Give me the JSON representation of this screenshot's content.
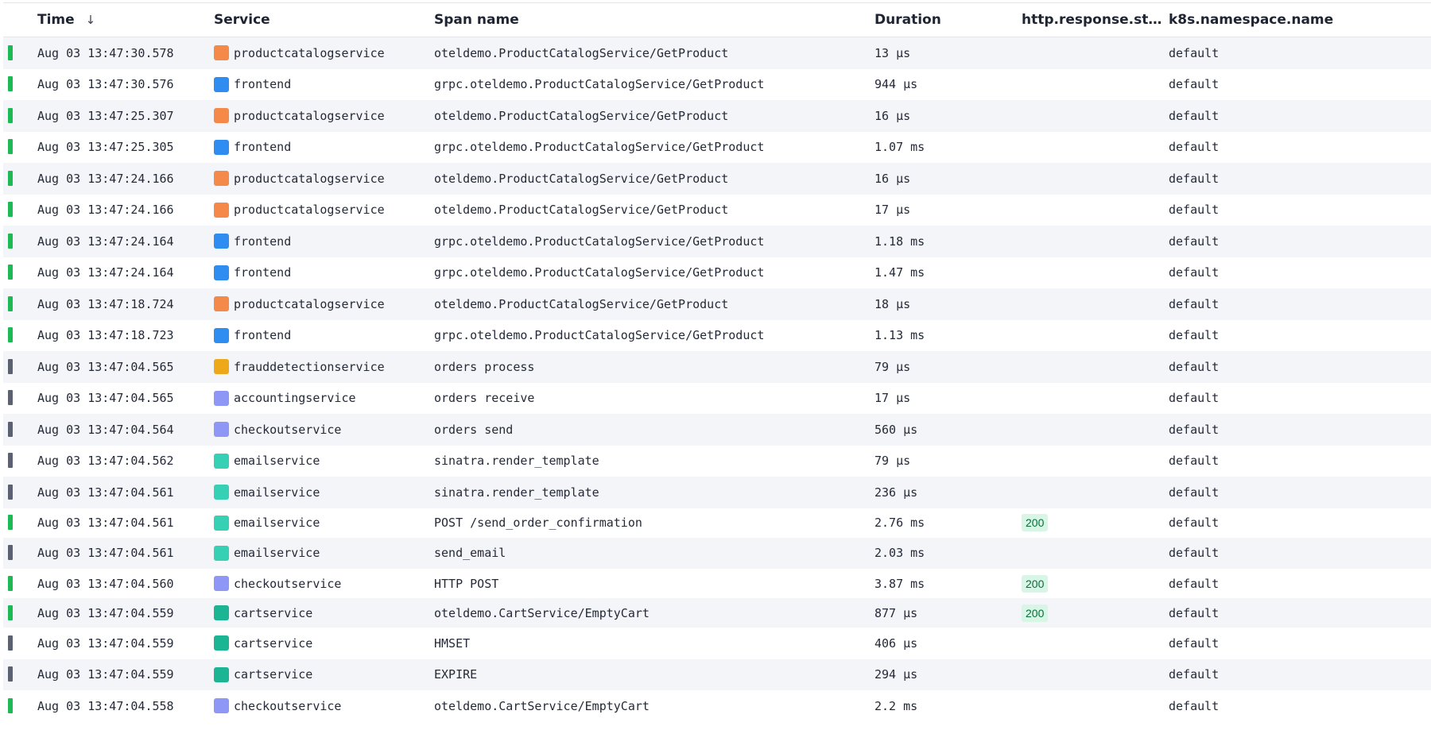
{
  "columns": {
    "time": "Time",
    "service": "Service",
    "span_name": "Span name",
    "duration": "Duration",
    "http_status": "http.response.stat…",
    "namespace": "k8s.namespace.name"
  },
  "sort_icon": "arrow-down-icon",
  "colors": {
    "status_ok": "#1db954",
    "status_unset": "#5b6170",
    "productcatalogservice": "#f5894a",
    "frontend": "#2f8cf0",
    "frauddetectionservice": "#eda91a",
    "accountingservice": "#8e97f5",
    "checkoutservice": "#8e97f5",
    "emailservice": "#36d1b4",
    "cartservice": "#1bb593"
  },
  "rows": [
    {
      "status": "ok",
      "time": "Aug 03 13:47:30.578",
      "service": "productcatalogservice",
      "span": "oteldemo.ProductCatalogService/GetProduct",
      "duration": "13 μs",
      "http": "",
      "namespace": "default"
    },
    {
      "status": "ok",
      "time": "Aug 03 13:47:30.576",
      "service": "frontend",
      "span": "grpc.oteldemo.ProductCatalogService/GetProduct",
      "duration": "944 μs",
      "http": "",
      "namespace": "default"
    },
    {
      "status": "ok",
      "time": "Aug 03 13:47:25.307",
      "service": "productcatalogservice",
      "span": "oteldemo.ProductCatalogService/GetProduct",
      "duration": "16 μs",
      "http": "",
      "namespace": "default"
    },
    {
      "status": "ok",
      "time": "Aug 03 13:47:25.305",
      "service": "frontend",
      "span": "grpc.oteldemo.ProductCatalogService/GetProduct",
      "duration": "1.07 ms",
      "http": "",
      "namespace": "default"
    },
    {
      "status": "ok",
      "time": "Aug 03 13:47:24.166",
      "service": "productcatalogservice",
      "span": "oteldemo.ProductCatalogService/GetProduct",
      "duration": "16 μs",
      "http": "",
      "namespace": "default"
    },
    {
      "status": "ok",
      "time": "Aug 03 13:47:24.166",
      "service": "productcatalogservice",
      "span": "oteldemo.ProductCatalogService/GetProduct",
      "duration": "17 μs",
      "http": "",
      "namespace": "default"
    },
    {
      "status": "ok",
      "time": "Aug 03 13:47:24.164",
      "service": "frontend",
      "span": "grpc.oteldemo.ProductCatalogService/GetProduct",
      "duration": "1.18 ms",
      "http": "",
      "namespace": "default"
    },
    {
      "status": "ok",
      "time": "Aug 03 13:47:24.164",
      "service": "frontend",
      "span": "grpc.oteldemo.ProductCatalogService/GetProduct",
      "duration": "1.47 ms",
      "http": "",
      "namespace": "default"
    },
    {
      "status": "ok",
      "time": "Aug 03 13:47:18.724",
      "service": "productcatalogservice",
      "span": "oteldemo.ProductCatalogService/GetProduct",
      "duration": "18 μs",
      "http": "",
      "namespace": "default"
    },
    {
      "status": "ok",
      "time": "Aug 03 13:47:18.723",
      "service": "frontend",
      "span": "grpc.oteldemo.ProductCatalogService/GetProduct",
      "duration": "1.13 ms",
      "http": "",
      "namespace": "default"
    },
    {
      "status": "unset",
      "time": "Aug 03 13:47:04.565",
      "service": "frauddetectionservice",
      "span": "orders process",
      "duration": "79 μs",
      "http": "",
      "namespace": "default"
    },
    {
      "status": "unset",
      "time": "Aug 03 13:47:04.565",
      "service": "accountingservice",
      "span": "orders receive",
      "duration": "17 μs",
      "http": "",
      "namespace": "default"
    },
    {
      "status": "unset",
      "time": "Aug 03 13:47:04.564",
      "service": "checkoutservice",
      "span": "orders send",
      "duration": "560 μs",
      "http": "",
      "namespace": "default"
    },
    {
      "status": "unset",
      "time": "Aug 03 13:47:04.562",
      "service": "emailservice",
      "span": "sinatra.render_template",
      "duration": "79 μs",
      "http": "",
      "namespace": "default"
    },
    {
      "status": "unset",
      "time": "Aug 03 13:47:04.561",
      "service": "emailservice",
      "span": "sinatra.render_template",
      "duration": "236 μs",
      "http": "",
      "namespace": "default"
    },
    {
      "status": "ok",
      "time": "Aug 03 13:47:04.561",
      "service": "emailservice",
      "span": "POST /send_order_confirmation",
      "duration": "2.76 ms",
      "http": "200",
      "namespace": "default"
    },
    {
      "status": "unset",
      "time": "Aug 03 13:47:04.561",
      "service": "emailservice",
      "span": "send_email",
      "duration": "2.03 ms",
      "http": "",
      "namespace": "default"
    },
    {
      "status": "ok",
      "time": "Aug 03 13:47:04.560",
      "service": "checkoutservice",
      "span": "HTTP POST",
      "duration": "3.87 ms",
      "http": "200",
      "namespace": "default"
    },
    {
      "status": "ok",
      "time": "Aug 03 13:47:04.559",
      "service": "cartservice",
      "span": "oteldemo.CartService/EmptyCart",
      "duration": "877 μs",
      "http": "200",
      "namespace": "default"
    },
    {
      "status": "unset",
      "time": "Aug 03 13:47:04.559",
      "service": "cartservice",
      "span": "HMSET",
      "duration": "406 μs",
      "http": "",
      "namespace": "default"
    },
    {
      "status": "unset",
      "time": "Aug 03 13:47:04.559",
      "service": "cartservice",
      "span": "EXPIRE",
      "duration": "294 μs",
      "http": "",
      "namespace": "default"
    },
    {
      "status": "ok",
      "time": "Aug 03 13:47:04.558",
      "service": "checkoutservice",
      "span": "oteldemo.CartService/EmptyCart",
      "duration": "2.2 ms",
      "http": "",
      "namespace": "default"
    }
  ]
}
